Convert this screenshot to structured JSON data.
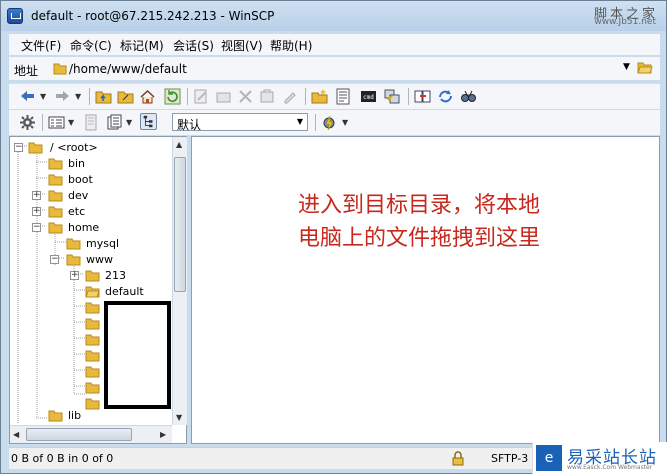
{
  "window": {
    "title": "default - root@67.215.242.213 - WinSCP"
  },
  "watermark": {
    "line1": "脚本之家",
    "line2": "www.Jb51.net"
  },
  "menu": {
    "items": [
      "文件(F)",
      "命令(C)",
      "标记(M)",
      "会话(S)",
      "视图(V)",
      "帮助(H)"
    ]
  },
  "address": {
    "label": "地址",
    "path": "/home/www/default"
  },
  "toolbar2": {
    "preset": "默认"
  },
  "tree": {
    "root": "/ <root>",
    "bin": "bin",
    "boot": "boot",
    "dev": "dev",
    "etc": "etc",
    "home": "home",
    "mysql": "mysql",
    "www": "www",
    "n213": "213",
    "default": "default",
    "lib": "lib"
  },
  "annotation": {
    "line1": "进入到目标目录，将本地",
    "line2": "电脑上的文件拖拽到这里"
  },
  "status": {
    "transfer": "0 B of 0 B in 0 of 0",
    "protocol": "SFTP-3"
  },
  "logo": {
    "text": "易采站长站",
    "sub": "www.Easck.Com Webmaster",
    "box": "e"
  },
  "colors": {
    "annotation": "#c8281d",
    "folder": "#e8b93a",
    "titlebar": "#c9dced"
  }
}
